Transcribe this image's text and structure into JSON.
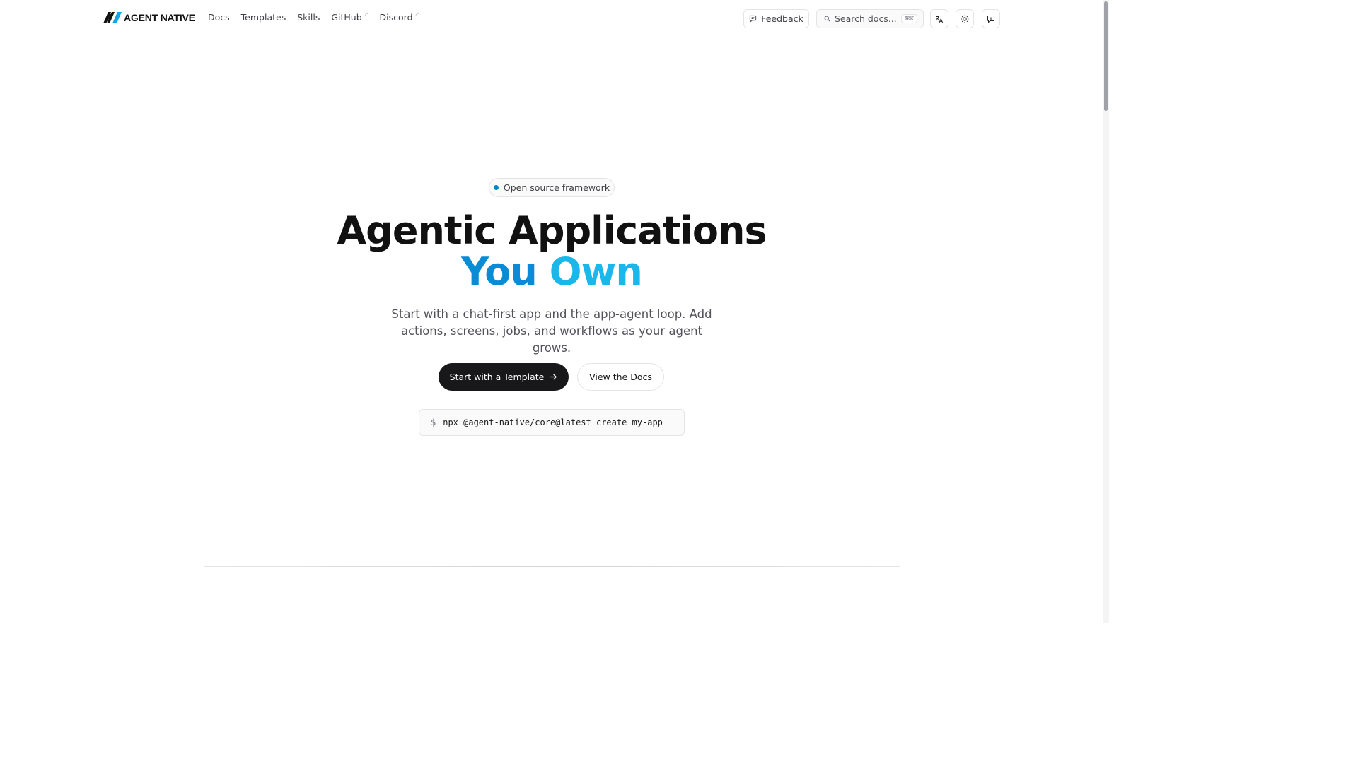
{
  "header": {
    "brand": "AGENT NATIVE",
    "nav": [
      {
        "label": "Docs",
        "external": false
      },
      {
        "label": "Templates",
        "external": false
      },
      {
        "label": "Skills",
        "external": false
      },
      {
        "label": "GitHub",
        "external": true
      },
      {
        "label": "Discord",
        "external": true
      }
    ],
    "external_marker": "↗",
    "feedback_label": "Feedback",
    "search": {
      "placeholder": "Search docs...",
      "shortcut": "⌘K"
    },
    "icons": [
      "translate-icon",
      "sun-icon",
      "chat-icon"
    ]
  },
  "hero": {
    "badge": "Open source framework",
    "title_line1": "Agentic Applications",
    "title_line2_word1": "You",
    "title_line2_word2": "Own",
    "subtitle": "Start with a chat-first app and the app-agent loop. Add actions, screens, jobs, and workflows as your agent grows.",
    "primary_cta": "Start with a Template",
    "secondary_cta": "View the Docs",
    "command_prompt": "$",
    "command": "npx @agent-native/core@latest create my-app"
  },
  "colors": {
    "accent": "#0ea5e9",
    "accent_dark": "#0a8cd4",
    "badge_dot": "#0284c7",
    "primary_button": "#18181b"
  }
}
